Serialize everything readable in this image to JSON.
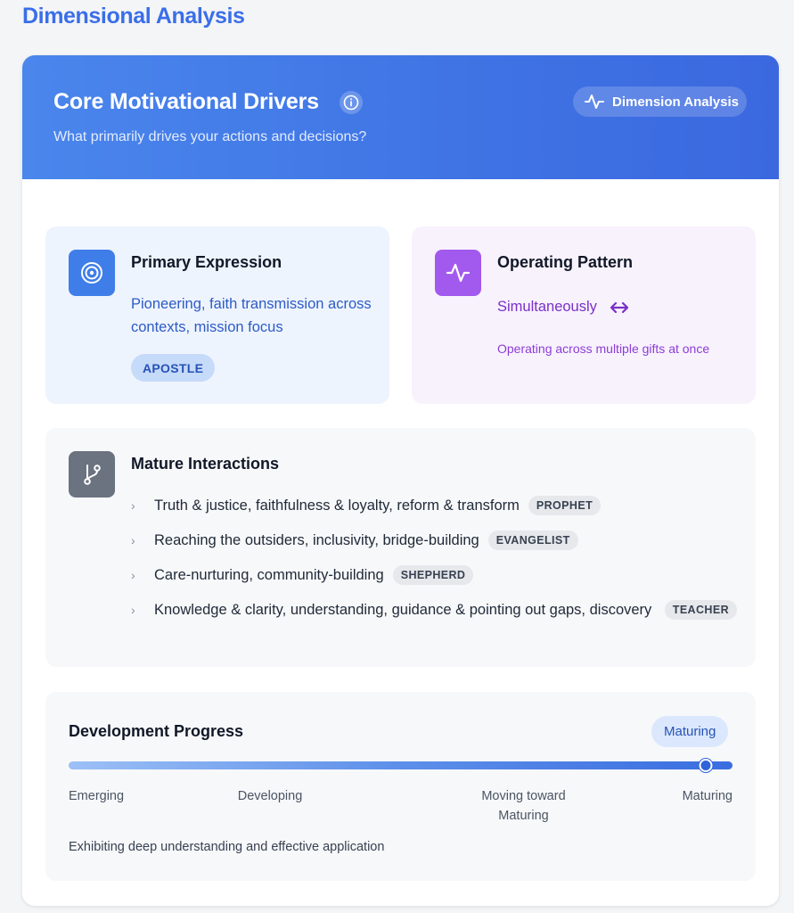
{
  "page": {
    "title": "Dimensional Analysis"
  },
  "hero": {
    "title": "Core Motivational Drivers",
    "subtitle": "What primarily drives your actions and decisions?",
    "button_label": "Dimension Analysis",
    "gradient_start": "#4a86ec",
    "gradient_end": "#3b68df",
    "icons": {
      "info": "info-icon",
      "button": "pulse-icon"
    }
  },
  "primary_expression": {
    "title": "Primary Expression",
    "description": "Pioneering, faith transmission across contexts, mission focus",
    "tag": "APOSTLE",
    "icon": "target-icon",
    "accent": "#3f7ee9"
  },
  "operating_pattern": {
    "title": "Operating Pattern",
    "value": "Simultaneously",
    "description": "Operating across multiple gifts at once",
    "icon": "pulse-icon",
    "value_icon": "double-arrow-icon",
    "accent": "#a259ee"
  },
  "mature_interactions": {
    "title": "Mature Interactions",
    "icon": "branch-icon",
    "items": [
      {
        "text": "Truth & justice, faithfulness & loyalty, reform & transform",
        "tag": "PROPHET"
      },
      {
        "text": "Reaching the outsiders, inclusivity, bridge-building",
        "tag": "EVANGELIST"
      },
      {
        "text": "Care-nurturing, community-building",
        "tag": "SHEPHERD"
      },
      {
        "text": "Knowledge & clarity, understanding, guidance & pointing out gaps, discovery",
        "tag": "TEACHER"
      }
    ]
  },
  "development_progress": {
    "title": "Development Progress",
    "badge": "Maturing",
    "progress": 0.96,
    "stages": [
      "Emerging",
      "Developing",
      "Moving toward Maturing",
      "Maturing"
    ],
    "description": "Exhibiting deep understanding and effective application"
  }
}
